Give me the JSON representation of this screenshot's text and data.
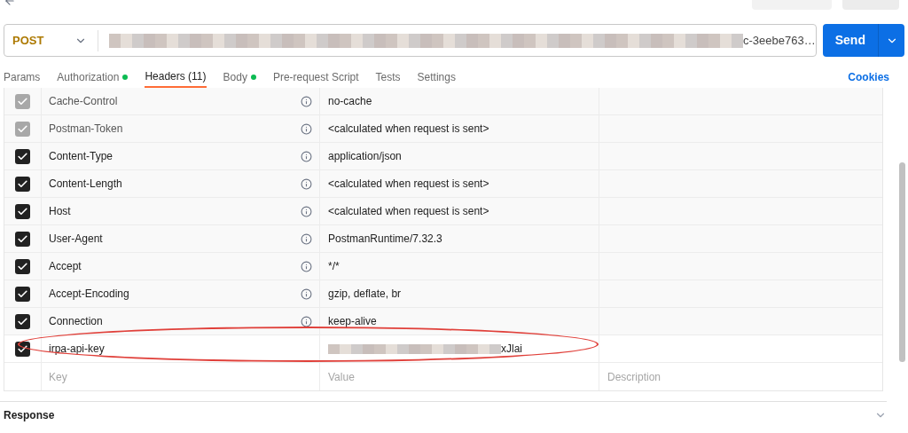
{
  "request": {
    "method": "POST",
    "url_tail": "c-3eebe763…",
    "send": "Send"
  },
  "tabs": [
    {
      "label": "Params",
      "selected": false,
      "dot": false
    },
    {
      "label": "Authorization",
      "selected": false,
      "dot": true
    },
    {
      "label": "Headers (11)",
      "selected": true,
      "dot": false
    },
    {
      "label": "Body",
      "selected": false,
      "dot": true
    },
    {
      "label": "Pre-request Script",
      "selected": false,
      "dot": false
    },
    {
      "label": "Tests",
      "selected": false,
      "dot": false
    },
    {
      "label": "Settings",
      "selected": false,
      "dot": false
    }
  ],
  "cookies": "Cookies",
  "headers": [
    {
      "key": "Cache-Control",
      "value": "no-cache",
      "checked": true,
      "disabled": true,
      "info": true
    },
    {
      "key": "Postman-Token",
      "value": "<calculated when request is sent>",
      "checked": true,
      "disabled": true,
      "info": true
    },
    {
      "key": "Content-Type",
      "value": "application/json",
      "checked": true,
      "disabled": false,
      "info": true
    },
    {
      "key": "Content-Length",
      "value": "<calculated when request is sent>",
      "checked": true,
      "disabled": false,
      "info": true
    },
    {
      "key": "Host",
      "value": "<calculated when request is sent>",
      "checked": true,
      "disabled": false,
      "info": true
    },
    {
      "key": "User-Agent",
      "value": "PostmanRuntime/7.32.3",
      "checked": true,
      "disabled": false,
      "info": true
    },
    {
      "key": "Accept",
      "value": "*/*",
      "checked": true,
      "disabled": false,
      "info": true
    },
    {
      "key": "Accept-Encoding",
      "value": "gzip, deflate, br",
      "checked": true,
      "disabled": false,
      "info": true
    },
    {
      "key": "Connection",
      "value": "keep-alive",
      "checked": true,
      "disabled": false,
      "info": true
    },
    {
      "key": "irpa-api-key",
      "value": "xJlai",
      "redacted": true,
      "checked": true,
      "disabled": false,
      "info": false,
      "highlighted": true
    }
  ],
  "new_row": {
    "key_placeholder": "Key",
    "value_placeholder": "Value",
    "description_placeholder": "Description"
  },
  "response": {
    "title": "Response"
  }
}
